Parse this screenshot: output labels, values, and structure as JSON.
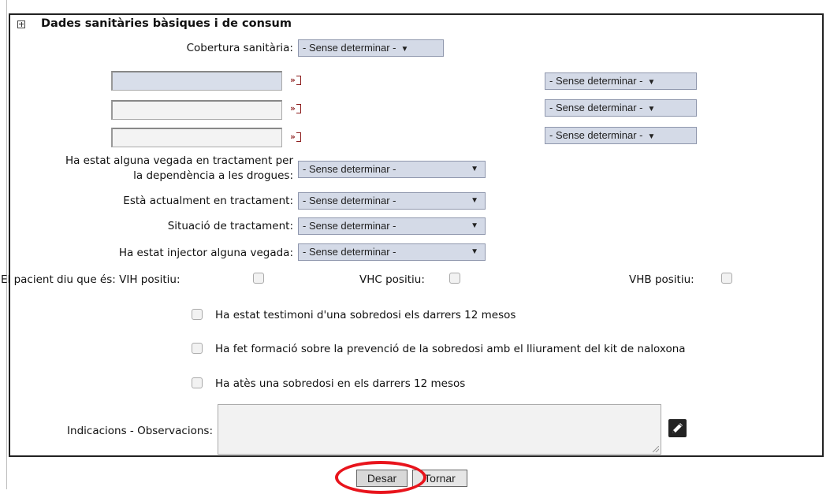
{
  "section": {
    "title": "Dades sanitàries bàsiques i de consum"
  },
  "cobertura": {
    "label": "Cobertura sanitària:",
    "value": "- Sense determinar -"
  },
  "sense_rows": [
    {
      "text": "",
      "link": "»",
      "select": "- Sense determinar -"
    },
    {
      "text": "",
      "link": "»",
      "select": "- Sense determinar -"
    },
    {
      "text": "",
      "link": "»",
      "select": "- Sense determinar -"
    }
  ],
  "questions": [
    {
      "label_line1": "Ha estat alguna vegada en tractament per",
      "label_line2": "la dependència a les drogues:",
      "value": "- Sense determinar -"
    },
    {
      "label": "Està actualment en tractament:",
      "value": "- Sense determinar -"
    },
    {
      "label": "Situació de tractament:",
      "value": "- Sense determinar -"
    },
    {
      "label": "Ha estat injector alguna vegada:",
      "value": "- Sense determinar -"
    }
  ],
  "patient": {
    "intro": "El pacient diu que és: VIH positiu:",
    "vhc": "VHC positiu:",
    "vhb": "VHB positiu:"
  },
  "checks": [
    "Ha estat testimoni d'una sobredosi els darrers 12 mesos",
    "Ha fet formació sobre la prevenció de la sobredosi amb el lliurament del kit de naloxona",
    "Ha atès una sobredosi en els darrers 12 mesos"
  ],
  "observacions": {
    "label": "Indicacions - Observacions:",
    "value": ""
  },
  "buttons": {
    "save": "Desar",
    "back": "Tornar"
  },
  "icons": {
    "expand": "plus-box-icon",
    "go": "link-arrow-icon",
    "edit": "pencil-icon"
  },
  "colors": {
    "select_bg": "#d4dae7",
    "highlight": "#e8141c",
    "link": "#8b1a1a"
  }
}
